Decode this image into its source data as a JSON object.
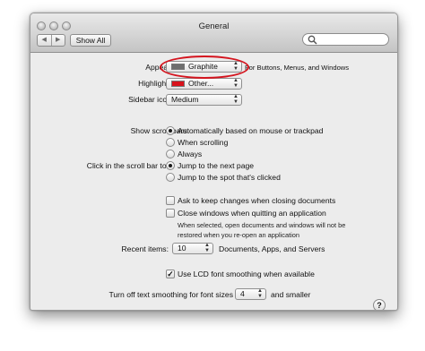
{
  "window": {
    "title": "General"
  },
  "toolbar": {
    "back": "◀",
    "forward": "▶",
    "show_all": "Show All",
    "search_placeholder": ""
  },
  "appearance": {
    "label": "Appearance:",
    "value": "Graphite",
    "swatch_color": "#6e6e6e",
    "note": "For Buttons, Menus, and Windows"
  },
  "highlight": {
    "label": "Highlight color:",
    "value": "Other...",
    "swatch_color": "#d8131c"
  },
  "sidebar_icon": {
    "label": "Sidebar icon size:",
    "value": "Medium"
  },
  "scroll_bars": {
    "label": "Show scroll bars:",
    "options": [
      "Automatically based on mouse or trackpad",
      "When scrolling",
      "Always"
    ],
    "selected": 0
  },
  "scroll_click": {
    "label": "Click in the scroll bar to:",
    "options": [
      "Jump to the next page",
      "Jump to the spot that's clicked"
    ],
    "selected": 0
  },
  "ask_keep": {
    "label": "Ask to keep changes when closing documents",
    "checked": false
  },
  "close_windows": {
    "label": "Close windows when quitting an application",
    "checked": false,
    "note_line1": "When selected, open documents and windows will not be",
    "note_line2": "restored when you re-open an application"
  },
  "recent_items": {
    "label": "Recent items:",
    "value": "10",
    "suffix": "Documents, Apps, and Servers"
  },
  "lcd": {
    "label": "Use LCD font smoothing when available",
    "checked": true
  },
  "smoothing": {
    "label": "Turn off text smoothing for font sizes",
    "value": "4",
    "suffix": "and smaller"
  },
  "help": {
    "label": "?"
  },
  "colors": {
    "highlight_oval": "#d4141e"
  }
}
